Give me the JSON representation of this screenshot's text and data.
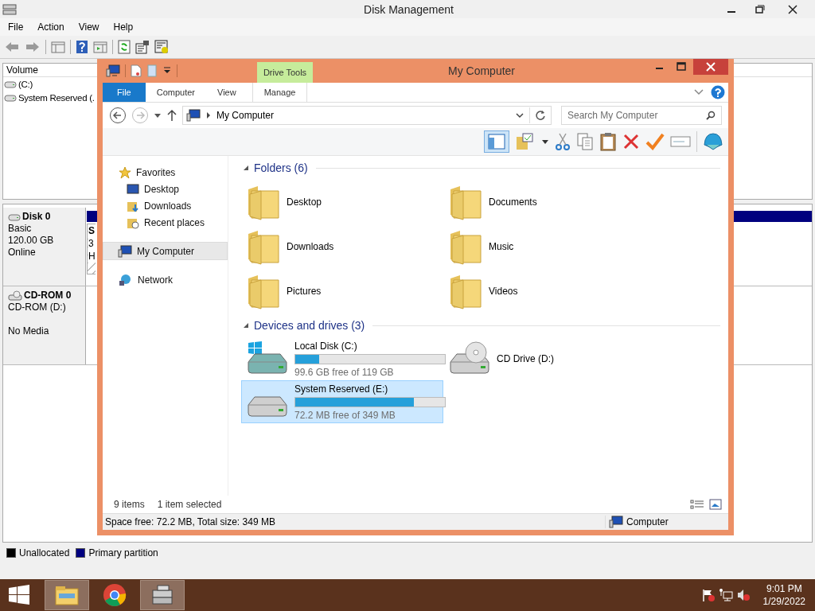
{
  "window": {
    "title": "Disk Management"
  },
  "menu": [
    "File",
    "Action",
    "View",
    "Help"
  ],
  "volume_list": {
    "column": "Volume",
    "rows": [
      "(C:)",
      "System Reserved (."
    ]
  },
  "disks": [
    {
      "name": "Disk 0",
      "kind": "disk",
      "lines": [
        "Basic",
        "120.00 GB",
        "Online"
      ],
      "partition_fragments": [
        "S",
        "3",
        "H"
      ]
    },
    {
      "name": "CD-ROM 0",
      "kind": "cdrom",
      "lines": [
        "CD-ROM (D:)",
        "No Media"
      ]
    }
  ],
  "legend": [
    {
      "label": "Unallocated",
      "color": "#000000"
    },
    {
      "label": "Primary partition",
      "color": "#00007f"
    }
  ],
  "explorer": {
    "title": "My Computer",
    "contextual_tab": "Drive Tools",
    "tabs": [
      {
        "label": "File",
        "kind": "file",
        "selected": false
      },
      {
        "label": "Computer",
        "kind": "tab",
        "selected": false
      },
      {
        "label": "View",
        "kind": "tab",
        "selected": false
      },
      {
        "label": "Manage",
        "kind": "tab",
        "selected": true
      }
    ],
    "address": "My Computer",
    "search": {
      "placeholder": "Search My Computer"
    },
    "nav": [
      {
        "label": "Favorites",
        "kind": "favorites",
        "selected": false,
        "children": [
          {
            "label": "Desktop",
            "kind": "desktop",
            "selected": false
          },
          {
            "label": "Downloads",
            "kind": "downloads",
            "selected": false
          },
          {
            "label": "Recent places",
            "kind": "recent",
            "selected": false
          }
        ]
      },
      {
        "label": "My Computer",
        "kind": "computer",
        "selected": true
      },
      {
        "label": "Network",
        "kind": "network",
        "selected": false
      }
    ],
    "groups": [
      {
        "title": "Folders (6)",
        "expanded": true,
        "items": [
          {
            "name": "Desktop",
            "kind": "folder",
            "selected": false
          },
          {
            "name": "Documents",
            "kind": "folder",
            "selected": false
          },
          {
            "name": "Downloads",
            "kind": "folder",
            "selected": false
          },
          {
            "name": "Music",
            "kind": "folder",
            "selected": false
          },
          {
            "name": "Pictures",
            "kind": "folder",
            "selected": false
          },
          {
            "name": "Videos",
            "kind": "folder",
            "selected": false
          }
        ]
      },
      {
        "title": "Devices and drives (3)",
        "expanded": true,
        "items": [
          {
            "name": "Local Disk (C:)",
            "kind": "system_drive",
            "level": 0.16,
            "free": "99.6 GB free of 119 GB",
            "selected": false
          },
          {
            "name": "CD Drive (D:)",
            "kind": "cd_drive",
            "selected": false
          },
          {
            "name": "System Reserved (E:)",
            "kind": "drive",
            "level": 0.79,
            "free": "72.2 MB free of 349 MB",
            "selected": true
          }
        ]
      }
    ],
    "status": {
      "count": "9 items",
      "selection": "1 item selected"
    },
    "details_bar": {
      "text": "Space free: 72.2 MB, Total size: 349 MB",
      "location": "Computer"
    }
  },
  "taskbar": {
    "apps": [
      {
        "kind": "explorer",
        "active": true
      },
      {
        "kind": "chrome",
        "active": false
      },
      {
        "kind": "diskmgmt",
        "active": true
      }
    ],
    "time": "9:01 PM",
    "date": "1/29/2022"
  }
}
